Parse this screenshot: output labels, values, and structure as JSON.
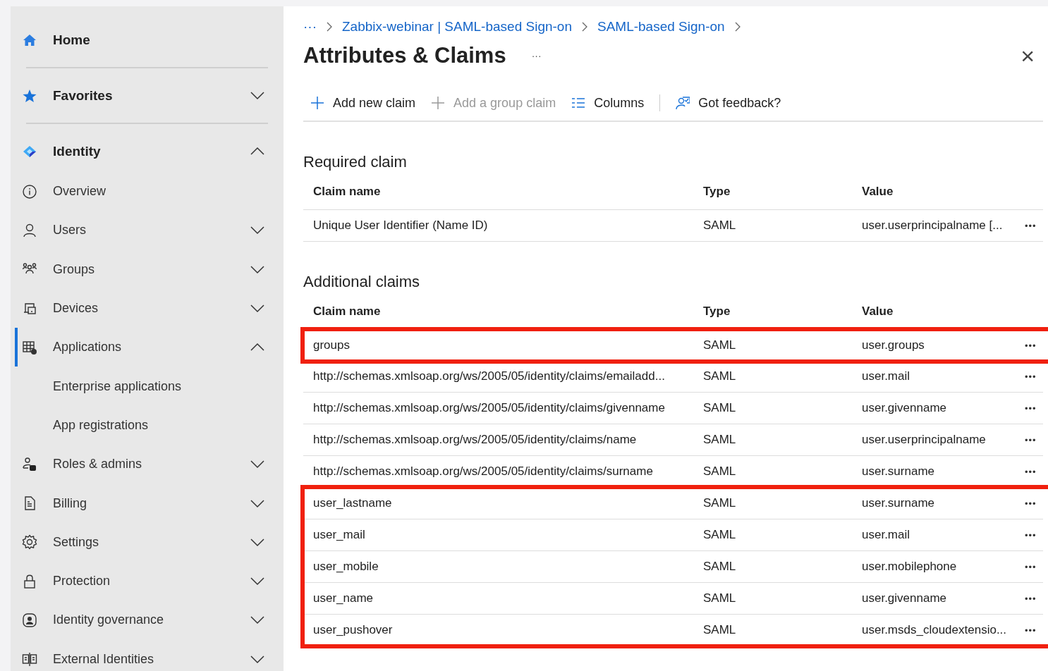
{
  "sidebar": {
    "items": [
      {
        "kind": "top",
        "label": "Home",
        "selected": false
      },
      {
        "kind": "top",
        "label": "Favorites",
        "expanded": false,
        "selected": false
      },
      {
        "kind": "top",
        "label": "Identity",
        "expanded": true,
        "selected": false
      },
      {
        "kind": "item",
        "label": "Overview",
        "selected": false
      },
      {
        "kind": "item",
        "label": "Users",
        "expanded": false,
        "selected": false
      },
      {
        "kind": "item",
        "label": "Groups",
        "expanded": false,
        "selected": false
      },
      {
        "kind": "item",
        "label": "Devices",
        "expanded": false,
        "selected": false
      },
      {
        "kind": "item",
        "label": "Applications",
        "expanded": true,
        "selected": true
      },
      {
        "kind": "subitem",
        "label": "Enterprise applications",
        "selected": false
      },
      {
        "kind": "subitem",
        "label": "App registrations",
        "selected": false
      },
      {
        "kind": "item",
        "label": "Roles & admins",
        "expanded": false,
        "selected": false
      },
      {
        "kind": "item",
        "label": "Billing",
        "expanded": false,
        "selected": false
      },
      {
        "kind": "item",
        "label": "Settings",
        "expanded": false,
        "selected": false
      },
      {
        "kind": "item",
        "label": "Protection",
        "expanded": false,
        "selected": false
      },
      {
        "kind": "item",
        "label": "Identity governance",
        "expanded": false,
        "selected": false
      },
      {
        "kind": "item",
        "label": "External Identities",
        "expanded": false,
        "selected": false
      }
    ]
  },
  "breadcrumb": {
    "overflow": "···",
    "links": [
      "Zabbix-webinar | SAML-based Sign-on",
      "SAML-based Sign-on"
    ]
  },
  "page": {
    "title": "Attributes & Claims",
    "more": "···",
    "close": "×"
  },
  "toolbar": [
    {
      "label": "Add new claim",
      "disabled": false
    },
    {
      "label": "Add a group claim",
      "disabled": true
    },
    {
      "label": "Columns",
      "disabled": false
    },
    {
      "label": "Got feedback?",
      "disabled": false
    }
  ],
  "sections": [
    {
      "title": "Required claim",
      "columns": [
        "Claim name",
        "Type",
        "Value"
      ],
      "rows": [
        {
          "name": "Unique User Identifier (Name ID)",
          "type": "SAML",
          "value": "user.userprincipalname [...",
          "more": "•••",
          "highlighted": false
        }
      ]
    },
    {
      "title": "Additional claims",
      "columns": [
        "Claim name",
        "Type",
        "Value"
      ],
      "rows": [
        {
          "name": "groups",
          "type": "SAML",
          "value": "user.groups",
          "more": "•••",
          "highlighted": true
        },
        {
          "name": "http://schemas.xmlsoap.org/ws/2005/05/identity/claims/emailadd...",
          "type": "SAML",
          "value": "user.mail",
          "more": "•••",
          "highlighted": false
        },
        {
          "name": "http://schemas.xmlsoap.org/ws/2005/05/identity/claims/givenname",
          "type": "SAML",
          "value": "user.givenname",
          "more": "•••",
          "highlighted": false
        },
        {
          "name": "http://schemas.xmlsoap.org/ws/2005/05/identity/claims/name",
          "type": "SAML",
          "value": "user.userprincipalname",
          "more": "•••",
          "highlighted": false
        },
        {
          "name": "http://schemas.xmlsoap.org/ws/2005/05/identity/claims/surname",
          "type": "SAML",
          "value": "user.surname",
          "more": "•••",
          "highlighted": false
        },
        {
          "name": "user_lastname",
          "type": "SAML",
          "value": "user.surname",
          "more": "•••",
          "highlighted": true
        },
        {
          "name": "user_mail",
          "type": "SAML",
          "value": "user.mail",
          "more": "•••",
          "highlighted": true
        },
        {
          "name": "user_mobile",
          "type": "SAML",
          "value": "user.mobilephone",
          "more": "•••",
          "highlighted": true
        },
        {
          "name": "user_name",
          "type": "SAML",
          "value": "user.givenname",
          "more": "•••",
          "highlighted": true
        },
        {
          "name": "user_pushover",
          "type": "SAML",
          "value": "user.msds_cloudextensio...",
          "more": "•••",
          "highlighted": true
        }
      ]
    }
  ]
}
